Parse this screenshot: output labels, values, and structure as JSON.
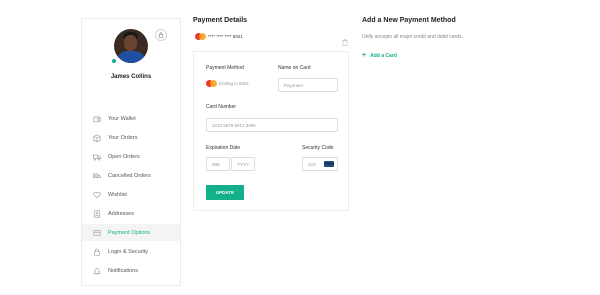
{
  "user": {
    "name": "James Collins"
  },
  "sidebar": {
    "items": [
      {
        "label": "Your Wallet",
        "icon": "wallet-icon",
        "active": false
      },
      {
        "label": "Your Orders",
        "icon": "orders-icon",
        "active": false
      },
      {
        "label": "Open Orders",
        "icon": "truck-icon",
        "active": false
      },
      {
        "label": "Cancelled Orders",
        "icon": "cancel-truck-icon",
        "active": false
      },
      {
        "label": "Wishlist",
        "icon": "heart-icon",
        "active": false
      },
      {
        "label": "Addresses",
        "icon": "address-book-icon",
        "active": false
      },
      {
        "label": "Payment Options",
        "icon": "payment-icon",
        "active": true
      },
      {
        "label": "Login & Security",
        "icon": "lock-icon",
        "active": false
      },
      {
        "label": "Notifications",
        "icon": "bell-icon",
        "active": false
      }
    ]
  },
  "payment_details": {
    "title": "Payment Details",
    "card_masked": "**** **** **** 5021"
  },
  "form": {
    "method_label": "Payment Method",
    "method_value": "Ending in 5021",
    "name_label": "Name on Card",
    "name_placeholder": "Payoneer",
    "number_label": "Card Number",
    "number_placeholder": "1234 5678 9012 3456",
    "expiry_label": "Expiration Date",
    "month_placeholder": "MM",
    "year_placeholder": "YYYY",
    "security_label": "Security Code",
    "security_placeholder": "123",
    "update_label": "UPDATE"
  },
  "add_new": {
    "title": "Add a New Payment Method",
    "description": "Unify accepts all major credit and debit cards.",
    "link_label": "Add a Card"
  },
  "colors": {
    "accent": "#13b08c",
    "border": "#ececec"
  }
}
